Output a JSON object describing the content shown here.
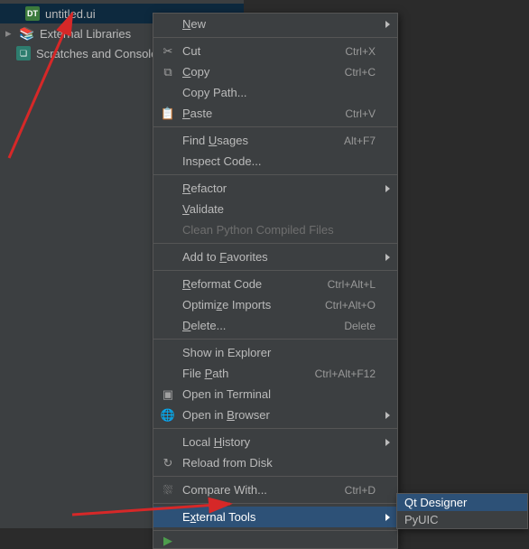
{
  "sidebar": {
    "items": [
      {
        "label": "untitled.ui",
        "icon": "DT"
      },
      {
        "label": "External Libraries",
        "icon": "lib"
      },
      {
        "label": "Scratches and Consoles",
        "icon": "scr"
      }
    ]
  },
  "context_menu": {
    "items": [
      {
        "key": "new",
        "label": "New",
        "mn": "N",
        "icon": "",
        "shortcut": "",
        "submenu": true
      },
      {
        "sep": true
      },
      {
        "key": "cut",
        "label": "Cut",
        "mn": "",
        "icon": "✂",
        "shortcut": "Ctrl+X"
      },
      {
        "key": "copy",
        "label": "Copy",
        "mn": "C",
        "icon": "⧉",
        "shortcut": "Ctrl+C"
      },
      {
        "key": "copypath",
        "label": "Copy Path...",
        "mn": "",
        "icon": "",
        "shortcut": ""
      },
      {
        "key": "paste",
        "label": "Paste",
        "mn": "P",
        "icon": "📋",
        "shortcut": "Ctrl+V"
      },
      {
        "sep": true
      },
      {
        "key": "findusages",
        "label": "Find Usages",
        "mn": "U",
        "icon": "",
        "shortcut": "Alt+F7"
      },
      {
        "key": "inspect",
        "label": "Inspect Code...",
        "mn": "",
        "icon": "",
        "shortcut": ""
      },
      {
        "sep": true
      },
      {
        "key": "refactor",
        "label": "Refactor",
        "mn": "R",
        "icon": "",
        "submenu": true
      },
      {
        "key": "validate",
        "label": "Validate",
        "mn": "V",
        "icon": "",
        "shortcut": ""
      },
      {
        "key": "clean",
        "label": "Clean Python Compiled Files",
        "disabled": true
      },
      {
        "sep": true
      },
      {
        "key": "favorites",
        "label": "Add to Favorites",
        "mn": "F",
        "submenu": true
      },
      {
        "sep": true
      },
      {
        "key": "reformat",
        "label": "Reformat Code",
        "mn": "R",
        "shortcut": "Ctrl+Alt+L"
      },
      {
        "key": "optimize",
        "label": "Optimize Imports",
        "mn": "z",
        "shortcut": "Ctrl+Alt+O"
      },
      {
        "key": "delete",
        "label": "Delete...",
        "mn": "D",
        "shortcut": "Delete"
      },
      {
        "sep": true
      },
      {
        "key": "explorer",
        "label": "Show in Explorer"
      },
      {
        "key": "filepath",
        "label": "File Path",
        "mn": "P",
        "shortcut": "Ctrl+Alt+F12"
      },
      {
        "key": "terminal",
        "label": "Open in Terminal",
        "icon": "▣"
      },
      {
        "key": "browser",
        "label": "Open in Browser",
        "mn": "B",
        "icon": "🌐",
        "submenu": true
      },
      {
        "sep": true
      },
      {
        "key": "history",
        "label": "Local History",
        "mn": "H",
        "submenu": true
      },
      {
        "key": "reload",
        "label": "Reload from Disk",
        "icon": "↻"
      },
      {
        "sep": true
      },
      {
        "key": "compare",
        "label": "Compare With...",
        "mn": "",
        "icon": "⛆",
        "shortcut": "Ctrl+D"
      },
      {
        "sep": true
      },
      {
        "key": "external",
        "label": "External Tools",
        "mn": "x",
        "submenu": true,
        "selected": true
      },
      {
        "sep": true
      },
      {
        "key": "truncated",
        "label": "",
        "icon": "▶",
        "truncated": true
      }
    ]
  },
  "submenu": {
    "items": [
      {
        "key": "qtdesigner",
        "label": "Qt Designer",
        "selected": true
      },
      {
        "key": "pyuic",
        "label": "PyUIC"
      }
    ]
  }
}
